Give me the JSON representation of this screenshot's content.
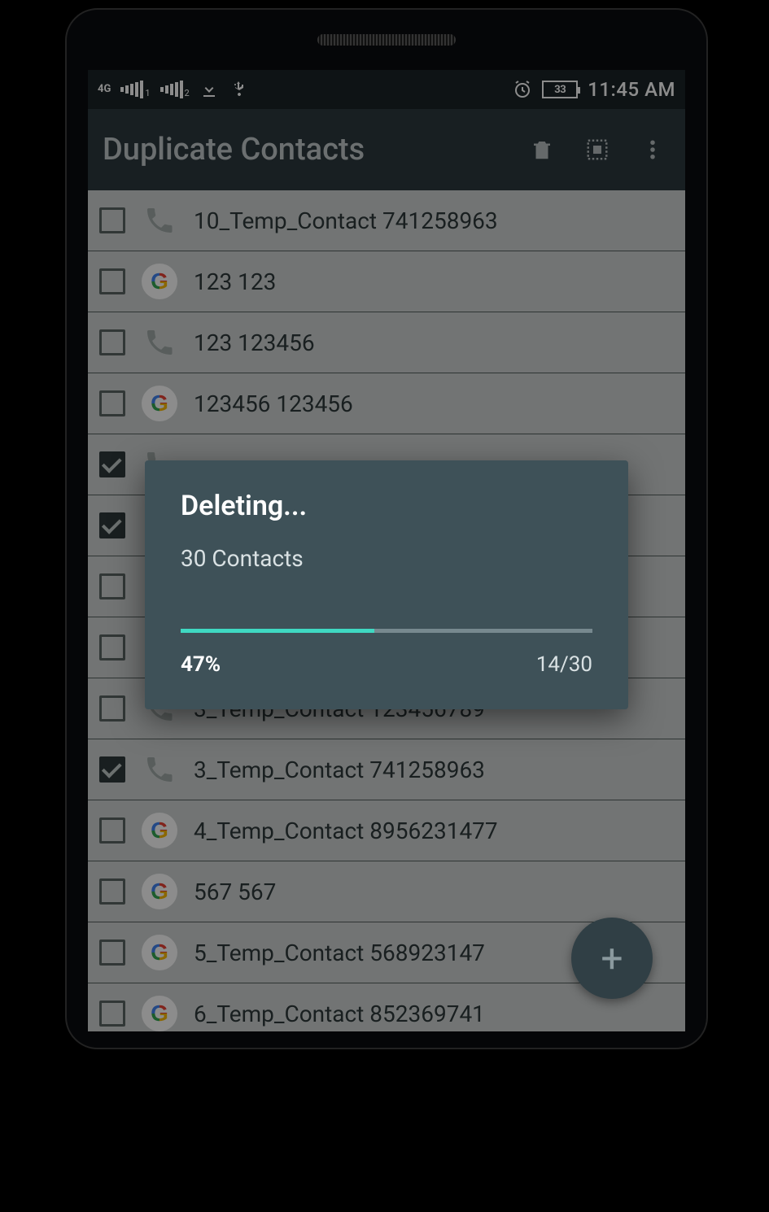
{
  "status_bar": {
    "network_badge": "4G",
    "sim1_sub": "1",
    "sim2_sub": "2",
    "battery_text": "33",
    "time": "11:45 AM"
  },
  "app_bar": {
    "title": "Duplicate Contacts"
  },
  "contacts": [
    {
      "checked": false,
      "icon": "phone",
      "name": "10_Temp_Contact 741258963"
    },
    {
      "checked": false,
      "icon": "google",
      "name": "123 123"
    },
    {
      "checked": false,
      "icon": "phone",
      "name": "123 123456"
    },
    {
      "checked": false,
      "icon": "google",
      "name": "123456 123456"
    },
    {
      "checked": true,
      "icon": "phone",
      "name": ""
    },
    {
      "checked": true,
      "icon": "phone",
      "name": ""
    },
    {
      "checked": false,
      "icon": "phone",
      "name": ""
    },
    {
      "checked": false,
      "icon": "phone",
      "name": ""
    },
    {
      "checked": false,
      "icon": "phone",
      "name": "3_Temp_Contact 123456789"
    },
    {
      "checked": true,
      "icon": "phone",
      "name": "3_Temp_Contact 741258963"
    },
    {
      "checked": false,
      "icon": "google",
      "name": "4_Temp_Contact 8956231477"
    },
    {
      "checked": false,
      "icon": "google",
      "name": "567 567"
    },
    {
      "checked": false,
      "icon": "google",
      "name": "5_Temp_Contact 568923147"
    },
    {
      "checked": false,
      "icon": "google",
      "name": "6_Temp_Contact 852369741"
    }
  ],
  "dialog": {
    "title": "Deleting...",
    "subtitle": "30 Contacts",
    "percent_label": "47%",
    "percent_value": 47,
    "count_label": "14/30"
  },
  "fab_label": "+"
}
